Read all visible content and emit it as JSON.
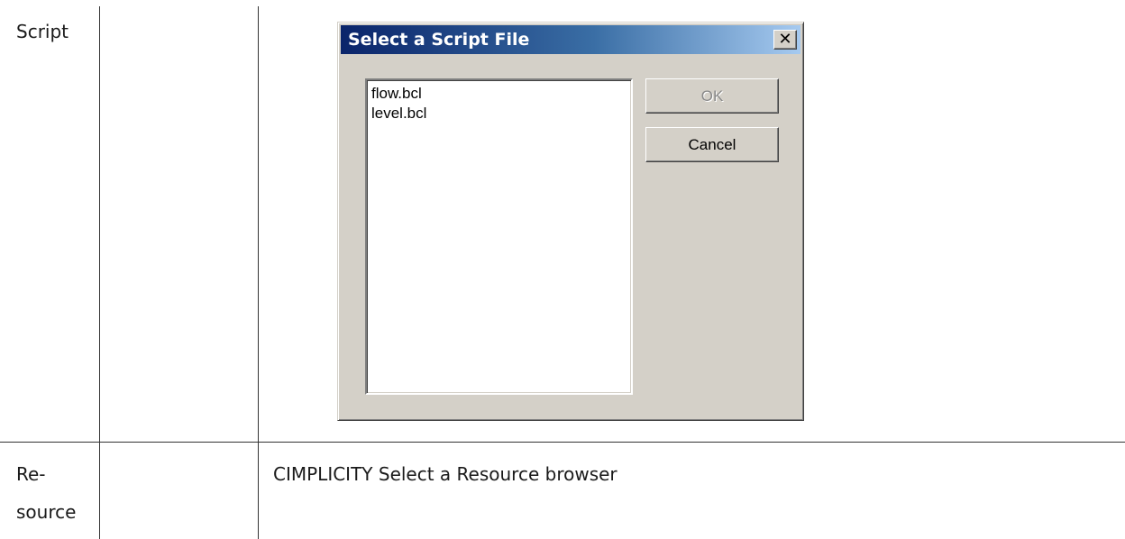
{
  "table": {
    "rows": [
      {
        "label": "Script"
      },
      {
        "label_line1": "Re-",
        "label_line2": "source",
        "description": "CIMPLICITY Select a Resource browser"
      }
    ]
  },
  "dialog": {
    "title": "Select a Script File",
    "close_glyph": "✕",
    "files": [
      "flow.bcl",
      "level.bcl"
    ],
    "ok_label": "OK",
    "cancel_label": "Cancel"
  }
}
